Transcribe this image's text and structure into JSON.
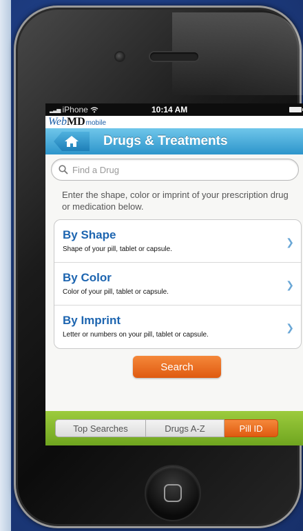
{
  "status_bar": {
    "carrier": "iPhone",
    "time": "10:14 AM"
  },
  "logo": {
    "web": "Web",
    "md": "MD",
    "mobile": "mobile"
  },
  "nav": {
    "title": "Drugs & Treatments"
  },
  "search": {
    "placeholder": "Find a Drug"
  },
  "instructions": "Enter the shape, color or imprint of your prescription drug or medication below.",
  "options": [
    {
      "title": "By Shape",
      "description": "Shape of your pill, tablet or capsule."
    },
    {
      "title": "By Color",
      "description": "Color of your pill, tablet or capsule."
    },
    {
      "title": "By Imprint",
      "description": "Letter or numbers on your pill, tablet or capsule."
    }
  ],
  "search_button": "Search",
  "tabs": [
    {
      "label": "Top Searches",
      "active": false
    },
    {
      "label": "Drugs A-Z",
      "active": false
    },
    {
      "label": "Pill ID",
      "active": true
    }
  ],
  "icons": {
    "home": "home-icon",
    "search": "search-icon",
    "chevron": "chevron-right-icon",
    "wifi": "wifi-icon",
    "battery": "battery-icon"
  },
  "colors": {
    "nav_blue": "#2d95cb",
    "link_blue": "#1d65b0",
    "accent_orange": "#df5a10",
    "tab_green": "#6fa51f"
  }
}
